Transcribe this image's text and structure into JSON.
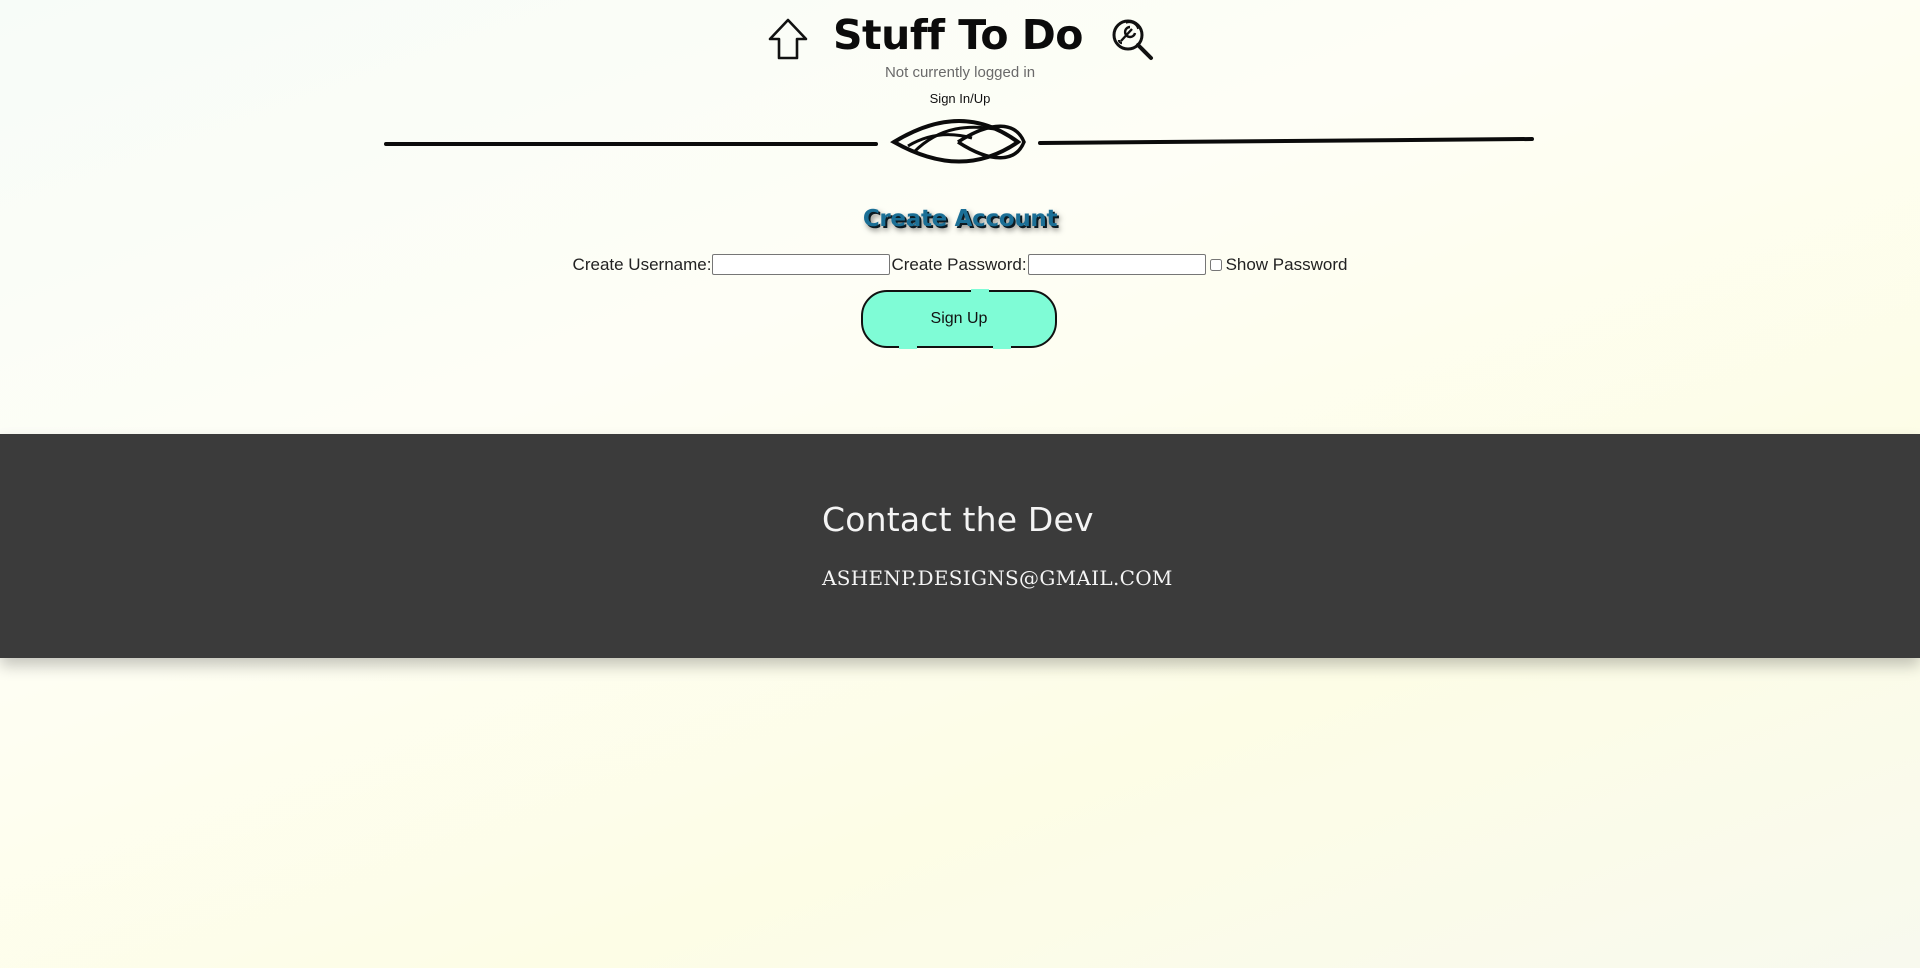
{
  "header": {
    "title": "Stuff To Do",
    "home_icon": "home-icon",
    "settings_icon": "wrench-search-icon",
    "login_status": "Not currently logged in",
    "signin_link": "Sign In/Up",
    "divider_icon": "ornament-divider"
  },
  "form": {
    "heading": "Create Account",
    "username_label": "Create Username:",
    "username_value": "",
    "password_label": "Create Password:",
    "password_value": "",
    "show_password_label": "Show Password",
    "show_password_checked": false,
    "submit_label": "Sign Up"
  },
  "footer": {
    "title": "Contact the Dev",
    "email": "ashenp.designs@gmail.com"
  },
  "colors": {
    "button_bg": "#7ffcd6",
    "footer_bg": "#3b3b3b",
    "heading_color": "#1b6f96"
  }
}
